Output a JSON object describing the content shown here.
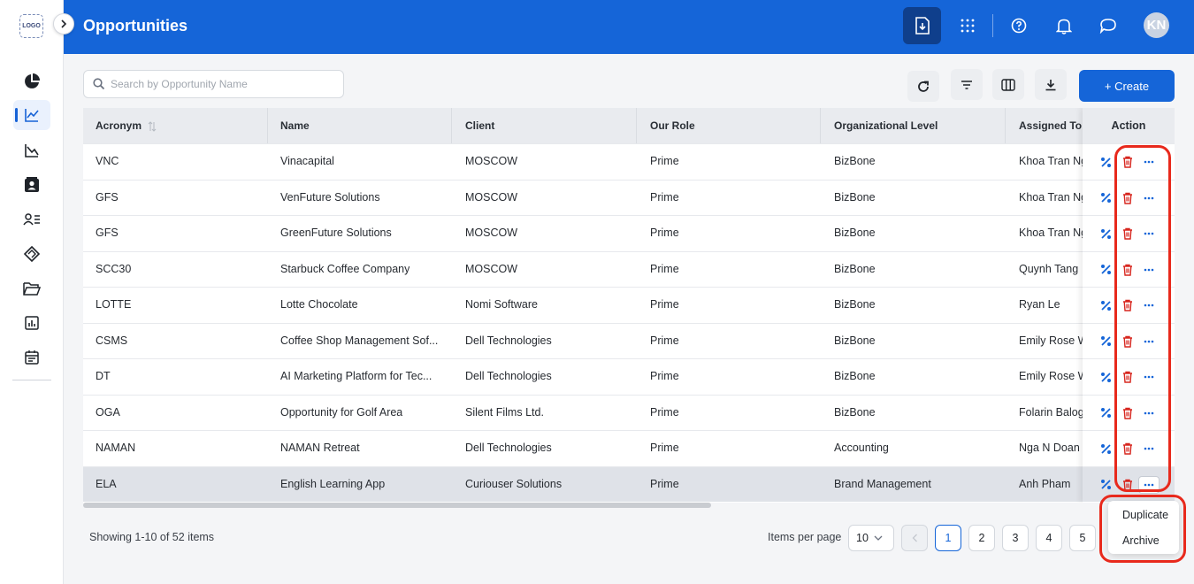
{
  "app": {
    "logo_text": "LOGO",
    "page_title": "Opportunities",
    "avatar_initials": "KN"
  },
  "colors": {
    "header_bg": "#1565d8",
    "accent": "#1565d8",
    "delete_icon": "#d7261e",
    "annotation": "#e8291c"
  },
  "sidebar": {
    "items": [
      {
        "icon": "pie-chart-icon",
        "active": false
      },
      {
        "icon": "line-chart-icon",
        "active": true
      },
      {
        "icon": "area-chart-icon",
        "active": false
      },
      {
        "icon": "contact-card-icon",
        "active": false
      },
      {
        "icon": "people-list-icon",
        "active": false
      },
      {
        "icon": "handshake-tag-icon",
        "active": false
      },
      {
        "icon": "folder-open-icon",
        "active": false
      },
      {
        "icon": "bar-report-icon",
        "active": false
      },
      {
        "icon": "calendar-icon",
        "active": false
      }
    ]
  },
  "header": {
    "buttons": [
      "download-file-icon",
      "apps-grid-icon",
      "help-icon",
      "bell-icon",
      "chat-icon"
    ]
  },
  "toolbar": {
    "search_placeholder": "Search by Opportunity Name",
    "search_value": "",
    "tools": [
      "refresh-icon",
      "filter-icon",
      "columns-icon",
      "download-icon"
    ],
    "create_label": "+ Create"
  },
  "table": {
    "columns": [
      "Acronym",
      "Name",
      "Client",
      "Our Role",
      "Organizational Level",
      "Assigned To"
    ],
    "action_header": "Action",
    "rows": [
      {
        "acronym": "VNC",
        "name": "Vinacapital",
        "client": "MOSCOW",
        "role": "Prime",
        "level": "BizBone",
        "assigned": "Khoa Tran Ng"
      },
      {
        "acronym": "GFS",
        "name": "VenFuture Solutions",
        "client": "MOSCOW",
        "role": "Prime",
        "level": "BizBone",
        "assigned": "Khoa Tran Ng"
      },
      {
        "acronym": "GFS",
        "name": "GreenFuture Solutions",
        "client": "MOSCOW",
        "role": "Prime",
        "level": "BizBone",
        "assigned": "Khoa Tran Ng"
      },
      {
        "acronym": "SCC30",
        "name": "Starbuck Coffee Company",
        "client": "MOSCOW",
        "role": "Prime",
        "level": "BizBone",
        "assigned": "Quynh Tang"
      },
      {
        "acronym": "LOTTE",
        "name": "Lotte Chocolate",
        "client": "Nomi Software",
        "role": "Prime",
        "level": "BizBone",
        "assigned": "Ryan Le"
      },
      {
        "acronym": "CSMS",
        "name": "Coffee Shop Management Sof...",
        "client": "Dell Technologies",
        "role": "Prime",
        "level": "BizBone",
        "assigned": "Emily Rose W"
      },
      {
        "acronym": "DT",
        "name": "AI Marketing Platform for Tec...",
        "client": "Dell Technologies",
        "role": "Prime",
        "level": "BizBone",
        "assigned": "Emily Rose W"
      },
      {
        "acronym": "OGA",
        "name": "Opportunity for Golf Area",
        "client": "Silent Films Ltd.",
        "role": "Prime",
        "level": "BizBone",
        "assigned": "Folarin Balog"
      },
      {
        "acronym": "NAMAN",
        "name": "NAMAN Retreat",
        "client": "Dell Technologies",
        "role": "Prime",
        "level": "Accounting",
        "assigned": "Nga N Doan"
      },
      {
        "acronym": "ELA",
        "name": "English Learning App",
        "client": "Curiouser Solutions",
        "role": "Prime",
        "level": "Brand Management",
        "assigned": "Anh Pham",
        "selected": true
      }
    ]
  },
  "footer": {
    "showing": "Showing 1-10 of 52 items",
    "items_per_page_label": "Items per page",
    "items_per_page_value": "10",
    "pages": [
      "1",
      "2",
      "3",
      "4",
      "5"
    ],
    "current_page": "1"
  },
  "menu": {
    "items": [
      "Duplicate",
      "Archive"
    ]
  }
}
